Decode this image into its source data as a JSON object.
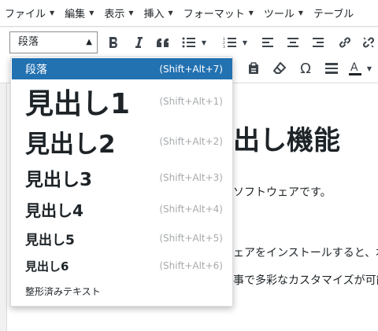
{
  "menubar": {
    "items": [
      {
        "label": "ファイル"
      },
      {
        "label": "編集"
      },
      {
        "label": "表示"
      },
      {
        "label": "挿入"
      },
      {
        "label": "フォーマット"
      },
      {
        "label": "ツール"
      },
      {
        "label": "テーブル"
      }
    ]
  },
  "toolbar": {
    "format_select_value": "段落",
    "text_color_letter": "A",
    "special_char": "Ω"
  },
  "editor": {
    "heading_partial": "出し機能",
    "line1": "ソフトウェアです。",
    "line2": "ェアをインストールすると、本格",
    "line3": "事で多彩なカスタマイズが可能"
  },
  "dropdown": {
    "items": [
      {
        "label": "段落",
        "shortcut": "(Shift+Alt+7)",
        "selected": true
      },
      {
        "label": "見出し1",
        "shortcut": "(Shift+Alt+1)"
      },
      {
        "label": "見出し2",
        "shortcut": "(Shift+Alt+2)"
      },
      {
        "label": "見出し3",
        "shortcut": "(Shift+Alt+3)"
      },
      {
        "label": "見出し4",
        "shortcut": "(Shift+Alt+4)"
      },
      {
        "label": "見出し5",
        "shortcut": "(Shift+Alt+5)"
      },
      {
        "label": "見出し6",
        "shortcut": "(Shift+Alt+6)"
      },
      {
        "label": "整形済みテキスト",
        "shortcut": ""
      }
    ]
  },
  "colors": {
    "selected_bg": "#2271b1",
    "shortcut_text": "#a7aaad",
    "icon": "#3c434a"
  }
}
